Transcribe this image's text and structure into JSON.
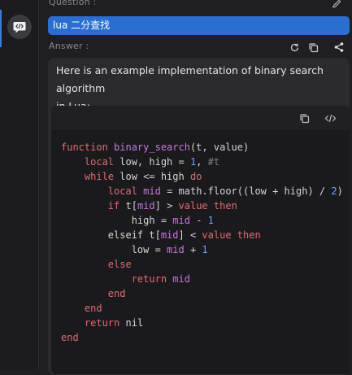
{
  "question": {
    "label": "Question :",
    "text": "lua 二分查找"
  },
  "answer": {
    "label": "Answer :",
    "intro_line1": "Here is an example implementation of binary search algorithm",
    "intro_line2": "in Lua:"
  },
  "code_lines": [
    [
      [
        "kw",
        "function "
      ],
      [
        "fn",
        "binary_search"
      ],
      [
        "p",
        "(t, value)"
      ]
    ],
    [
      [
        "p",
        "    "
      ],
      [
        "kw",
        "local"
      ],
      [
        "p",
        " low, high = "
      ],
      [
        "num",
        "1"
      ],
      [
        "p",
        ", "
      ],
      [
        "cm",
        "#t"
      ]
    ],
    [
      [
        "p",
        "    "
      ],
      [
        "kw",
        "while"
      ],
      [
        "p",
        " low <= high "
      ],
      [
        "kw",
        "do"
      ]
    ],
    [
      [
        "p",
        "        "
      ],
      [
        "kw",
        "local"
      ],
      [
        "p",
        " "
      ],
      [
        "id",
        "mid"
      ],
      [
        "p",
        " = math.floor((low + high) / "
      ],
      [
        "num",
        "2"
      ],
      [
        "p",
        ")"
      ]
    ],
    [
      [
        "p",
        "        "
      ],
      [
        "kw",
        "if"
      ],
      [
        "p",
        " t["
      ],
      [
        "id",
        "mid"
      ],
      [
        "p",
        "] > "
      ],
      [
        "kw",
        "value"
      ],
      [
        "p",
        " "
      ],
      [
        "kw",
        "then"
      ]
    ],
    [
      [
        "p",
        "            high = "
      ],
      [
        "id",
        "mid"
      ],
      [
        "p",
        " - "
      ],
      [
        "num",
        "1"
      ]
    ],
    [
      [
        "p",
        "        elseif t["
      ],
      [
        "id",
        "mid"
      ],
      [
        "p",
        "] < "
      ],
      [
        "kw",
        "value"
      ],
      [
        "p",
        " "
      ],
      [
        "kw",
        "then"
      ]
    ],
    [
      [
        "p",
        "            low = "
      ],
      [
        "id",
        "mid"
      ],
      [
        "p",
        " + "
      ],
      [
        "num",
        "1"
      ]
    ],
    [
      [
        "p",
        "        "
      ],
      [
        "kw",
        "else"
      ]
    ],
    [
      [
        "p",
        "            "
      ],
      [
        "kw",
        "return"
      ],
      [
        "p",
        " "
      ],
      [
        "id",
        "mid"
      ]
    ],
    [
      [
        "p",
        "        "
      ],
      [
        "kw",
        "end"
      ]
    ],
    [
      [
        "p",
        "    "
      ],
      [
        "kw",
        "end"
      ]
    ],
    [
      [
        "p",
        "    "
      ],
      [
        "kw",
        "return"
      ],
      [
        "p",
        " nil"
      ]
    ],
    [
      [
        "kw",
        "end"
      ]
    ]
  ],
  "icons": {
    "rail": "code-chat-icon",
    "edit": "pencil-icon",
    "refresh": "refresh-icon",
    "copy": "copy-icon",
    "share": "share-icon",
    "code_copy": "copy-icon",
    "code_view": "code-icon"
  },
  "colors": {
    "accent": "#2a6fd0",
    "keyword": "#e06c75",
    "function": "#c678dd",
    "number": "#6ea3ff"
  }
}
